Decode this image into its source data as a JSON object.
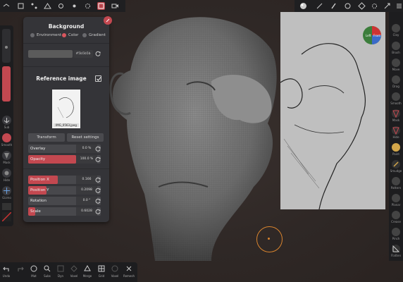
{
  "panel": {
    "background_title": "Background",
    "background_options": [
      {
        "label": "Environment",
        "selected": false
      },
      {
        "label": "Color",
        "selected": true
      },
      {
        "label": "Gradient",
        "selected": false
      }
    ],
    "color_hex": "#5b5b5b",
    "color_value": "#5b5b5b",
    "reference_title": "Reference image",
    "reference_checked": true,
    "image_filename": "IMG_0563.jpeg",
    "transform_label": "Transform",
    "reset_settings_label": "Reset settings",
    "rows": [
      {
        "label": "Overlay",
        "value": "0.0 %",
        "fill": 0
      },
      {
        "label": "Opacity",
        "value": "100.0 %",
        "fill": 1.0
      },
      {
        "label": "Position X",
        "value": "0.166",
        "fill": 0.62
      },
      {
        "label": "Position Y",
        "value": "0.2098",
        "fill": 0.38
      },
      {
        "label": "Rotation",
        "value": "0.0 °",
        "fill": 0
      },
      {
        "label": "Scale",
        "value": "0.6028",
        "fill": 0.14
      }
    ]
  },
  "left_toolbar": {
    "labels": [
      "Sub",
      "Smooth",
      "Mask",
      "Hide",
      "Gizmo"
    ]
  },
  "right_toolbar": {
    "labels": [
      "Clay",
      "Brush",
      "Move",
      "Drag",
      "Smooth",
      "Mask",
      "Hide",
      "Paint",
      "Smudge",
      "Pattern",
      "Planar",
      "Crease",
      "Pinch",
      "Flatten"
    ]
  },
  "bottom_toolbar": {
    "labels": [
      "Undo",
      "",
      "Mat",
      "Subs",
      "Dyn",
      "Voxel",
      "Merge",
      "Grid",
      "Voxel",
      "Remesh"
    ]
  },
  "gizmo": {
    "left_label": "Left",
    "front_label": "Front",
    "top_label": "Top"
  },
  "colors": {
    "accent": "#c34850",
    "cursor": "#d9842e",
    "panel": "#343438",
    "toolbar": "#1d1d1f"
  }
}
